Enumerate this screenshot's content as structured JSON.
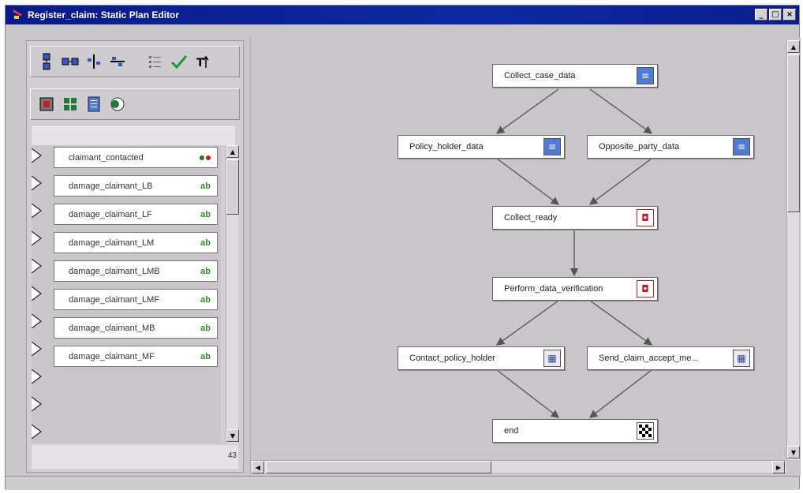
{
  "window": {
    "title": "Register_claim: Static Plan Editor",
    "controls": [
      "_",
      "□",
      "×"
    ]
  },
  "toolbar": {
    "row1_icons": [
      "vertical-layout-icon",
      "horizontal-layout-icon",
      "align-vertical-icon",
      "align-horizontal-icon",
      "list-icon",
      "check-icon",
      "sort-up-icon"
    ],
    "row2_icons": [
      "variable-icon",
      "grid-icon",
      "form-icon",
      "toggle-icon"
    ]
  },
  "variables": {
    "items": [
      {
        "label": "claimant_contacted",
        "type": "dots"
      },
      {
        "label": "damage_claimant_LB",
        "type": "ab"
      },
      {
        "label": "damage_claimant_LF",
        "type": "ab"
      },
      {
        "label": "damage_claimant_LM",
        "type": "ab"
      },
      {
        "label": "damage_claimant_LMB",
        "type": "ab"
      },
      {
        "label": "damage_claimant_LMF",
        "type": "ab"
      },
      {
        "label": "damage_claimant_MB",
        "type": "ab"
      },
      {
        "label": "damage_claimant_MF",
        "type": "ab"
      }
    ],
    "type_label": "ab",
    "count": "43"
  },
  "graph": {
    "nodes": [
      {
        "id": "n1",
        "label": "Collect_case_data",
        "icon": "form-icon"
      },
      {
        "id": "n2",
        "label": "Policy_holder_data",
        "icon": "form-icon"
      },
      {
        "id": "n3",
        "label": "Opposite_party_data",
        "icon": "form-icon"
      },
      {
        "id": "n4",
        "label": "Collect_ready",
        "icon": "decision-icon"
      },
      {
        "id": "n5",
        "label": "Perform_data_verification",
        "icon": "decision-icon"
      },
      {
        "id": "n6",
        "label": "Contact_policy_holder",
        "icon": "task-icon"
      },
      {
        "id": "n7",
        "label": "Send_claim_accept_me...",
        "icon": "task-icon"
      },
      {
        "id": "n8",
        "label": "end",
        "icon": "end-icon"
      }
    ]
  },
  "colors": {
    "titlebar": "#0c2aa0",
    "background": "#c9c6c9",
    "form_icon": "#4f7bd6",
    "decision_icon": "#c0202a",
    "dot_dark": "#2f6b2f",
    "dot_red": "#d01a1a"
  }
}
